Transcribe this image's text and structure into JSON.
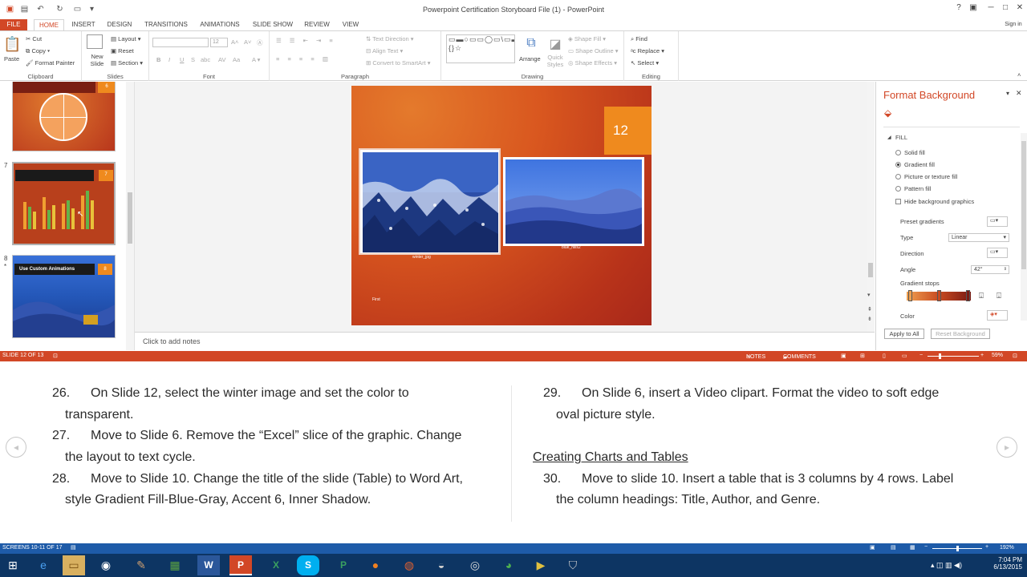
{
  "window": {
    "title": "Powerpoint Certification Storyboard File (1) - PowerPoint",
    "sign_in": "Sign in"
  },
  "tabs": [
    "FILE",
    "HOME",
    "INSERT",
    "DESIGN",
    "TRANSITIONS",
    "ANIMATIONS",
    "SLIDE SHOW",
    "REVIEW",
    "VIEW"
  ],
  "ribbon": {
    "clipboard": {
      "paste": "Paste",
      "cut": "Cut",
      "copy": "Copy",
      "format_painter": "Format Painter",
      "label": "Clipboard"
    },
    "slides": {
      "new_slide": "New Slide",
      "layout": "Layout",
      "reset": "Reset",
      "section": "Section",
      "label": "Slides"
    },
    "font": {
      "size": "12",
      "label": "Font"
    },
    "paragraph": {
      "text_direction": "Text Direction",
      "align_text": "Align Text",
      "convert_smartart": "Convert to SmartArt",
      "label": "Paragraph"
    },
    "drawing": {
      "arrange": "Arrange",
      "quick_styles": "Quick Styles",
      "shape_fill": "Shape Fill",
      "shape_outline": "Shape Outline",
      "shape_effects": "Shape Effects",
      "label": "Drawing"
    },
    "editing": {
      "find": "Find",
      "replace": "Replace",
      "select": "Select",
      "label": "Editing"
    }
  },
  "thumbnails": [
    {
      "num": "",
      "badge": "6"
    },
    {
      "num": "7",
      "badge": "7"
    },
    {
      "num": "8",
      "badge": "8",
      "title": "Use Custom Animations"
    }
  ],
  "slide": {
    "number": "12",
    "image1_caption": "winter_jpg",
    "image2_caption": "blue_hills2",
    "footer_text": "First"
  },
  "notes_placeholder": "Click to add notes",
  "format_background": {
    "title": "Format Background",
    "fill_header": "FILL",
    "options": [
      "Solid fill",
      "Gradient fill",
      "Picture or texture fill",
      "Pattern fill"
    ],
    "selected": "Gradient fill",
    "hide_graphics": "Hide background graphics",
    "preset_gradients": "Preset gradients",
    "type_label": "Type",
    "type_value": "Linear",
    "direction_label": "Direction",
    "angle_label": "Angle",
    "angle_value": "42°",
    "gradient_stops": "Gradient stops",
    "color_label": "Color",
    "apply_all": "Apply to All",
    "reset_bg": "Reset Background"
  },
  "status": {
    "slide": "SLIDE 12 OF 13",
    "notes": "NOTES",
    "comments": "COMMENTS",
    "zoom": "59%"
  },
  "lesson": {
    "left": [
      {
        "num": "26.",
        "line1": "On Slide 12, select the winter image and set the color to",
        "line2": "transparent."
      },
      {
        "num": "27.",
        "line1": "Move to Slide 6.  Remove the “Excel” slice of the graphic.  Change",
        "line2": "the layout to text cycle."
      },
      {
        "num": "28.",
        "line1": "Move to Slide 10. Change the title of the slide (Table) to Word Art,",
        "line2": "style Gradient  Fill-Blue-Gray, Accent 6, Inner Shadow."
      }
    ],
    "right": [
      {
        "num": "29.",
        "line1": "On Slide 6, insert a Video clipart.  Format the video to soft edge",
        "line2": "oval picture style."
      }
    ],
    "section_heading": "Creating Charts and Tables",
    "right2": [
      {
        "num": "30.",
        "line1": "Move to slide 10. Insert a table that is 3 columns by 4 rows. Label",
        "line2": "the column headings: Title, Author, and Genre."
      }
    ]
  },
  "bottom_status": {
    "screens": "SCREENS 10-11 OF 17",
    "zoom": "192%"
  },
  "taskbar": {
    "time": "7:04 PM",
    "date": "6/13/2015"
  }
}
